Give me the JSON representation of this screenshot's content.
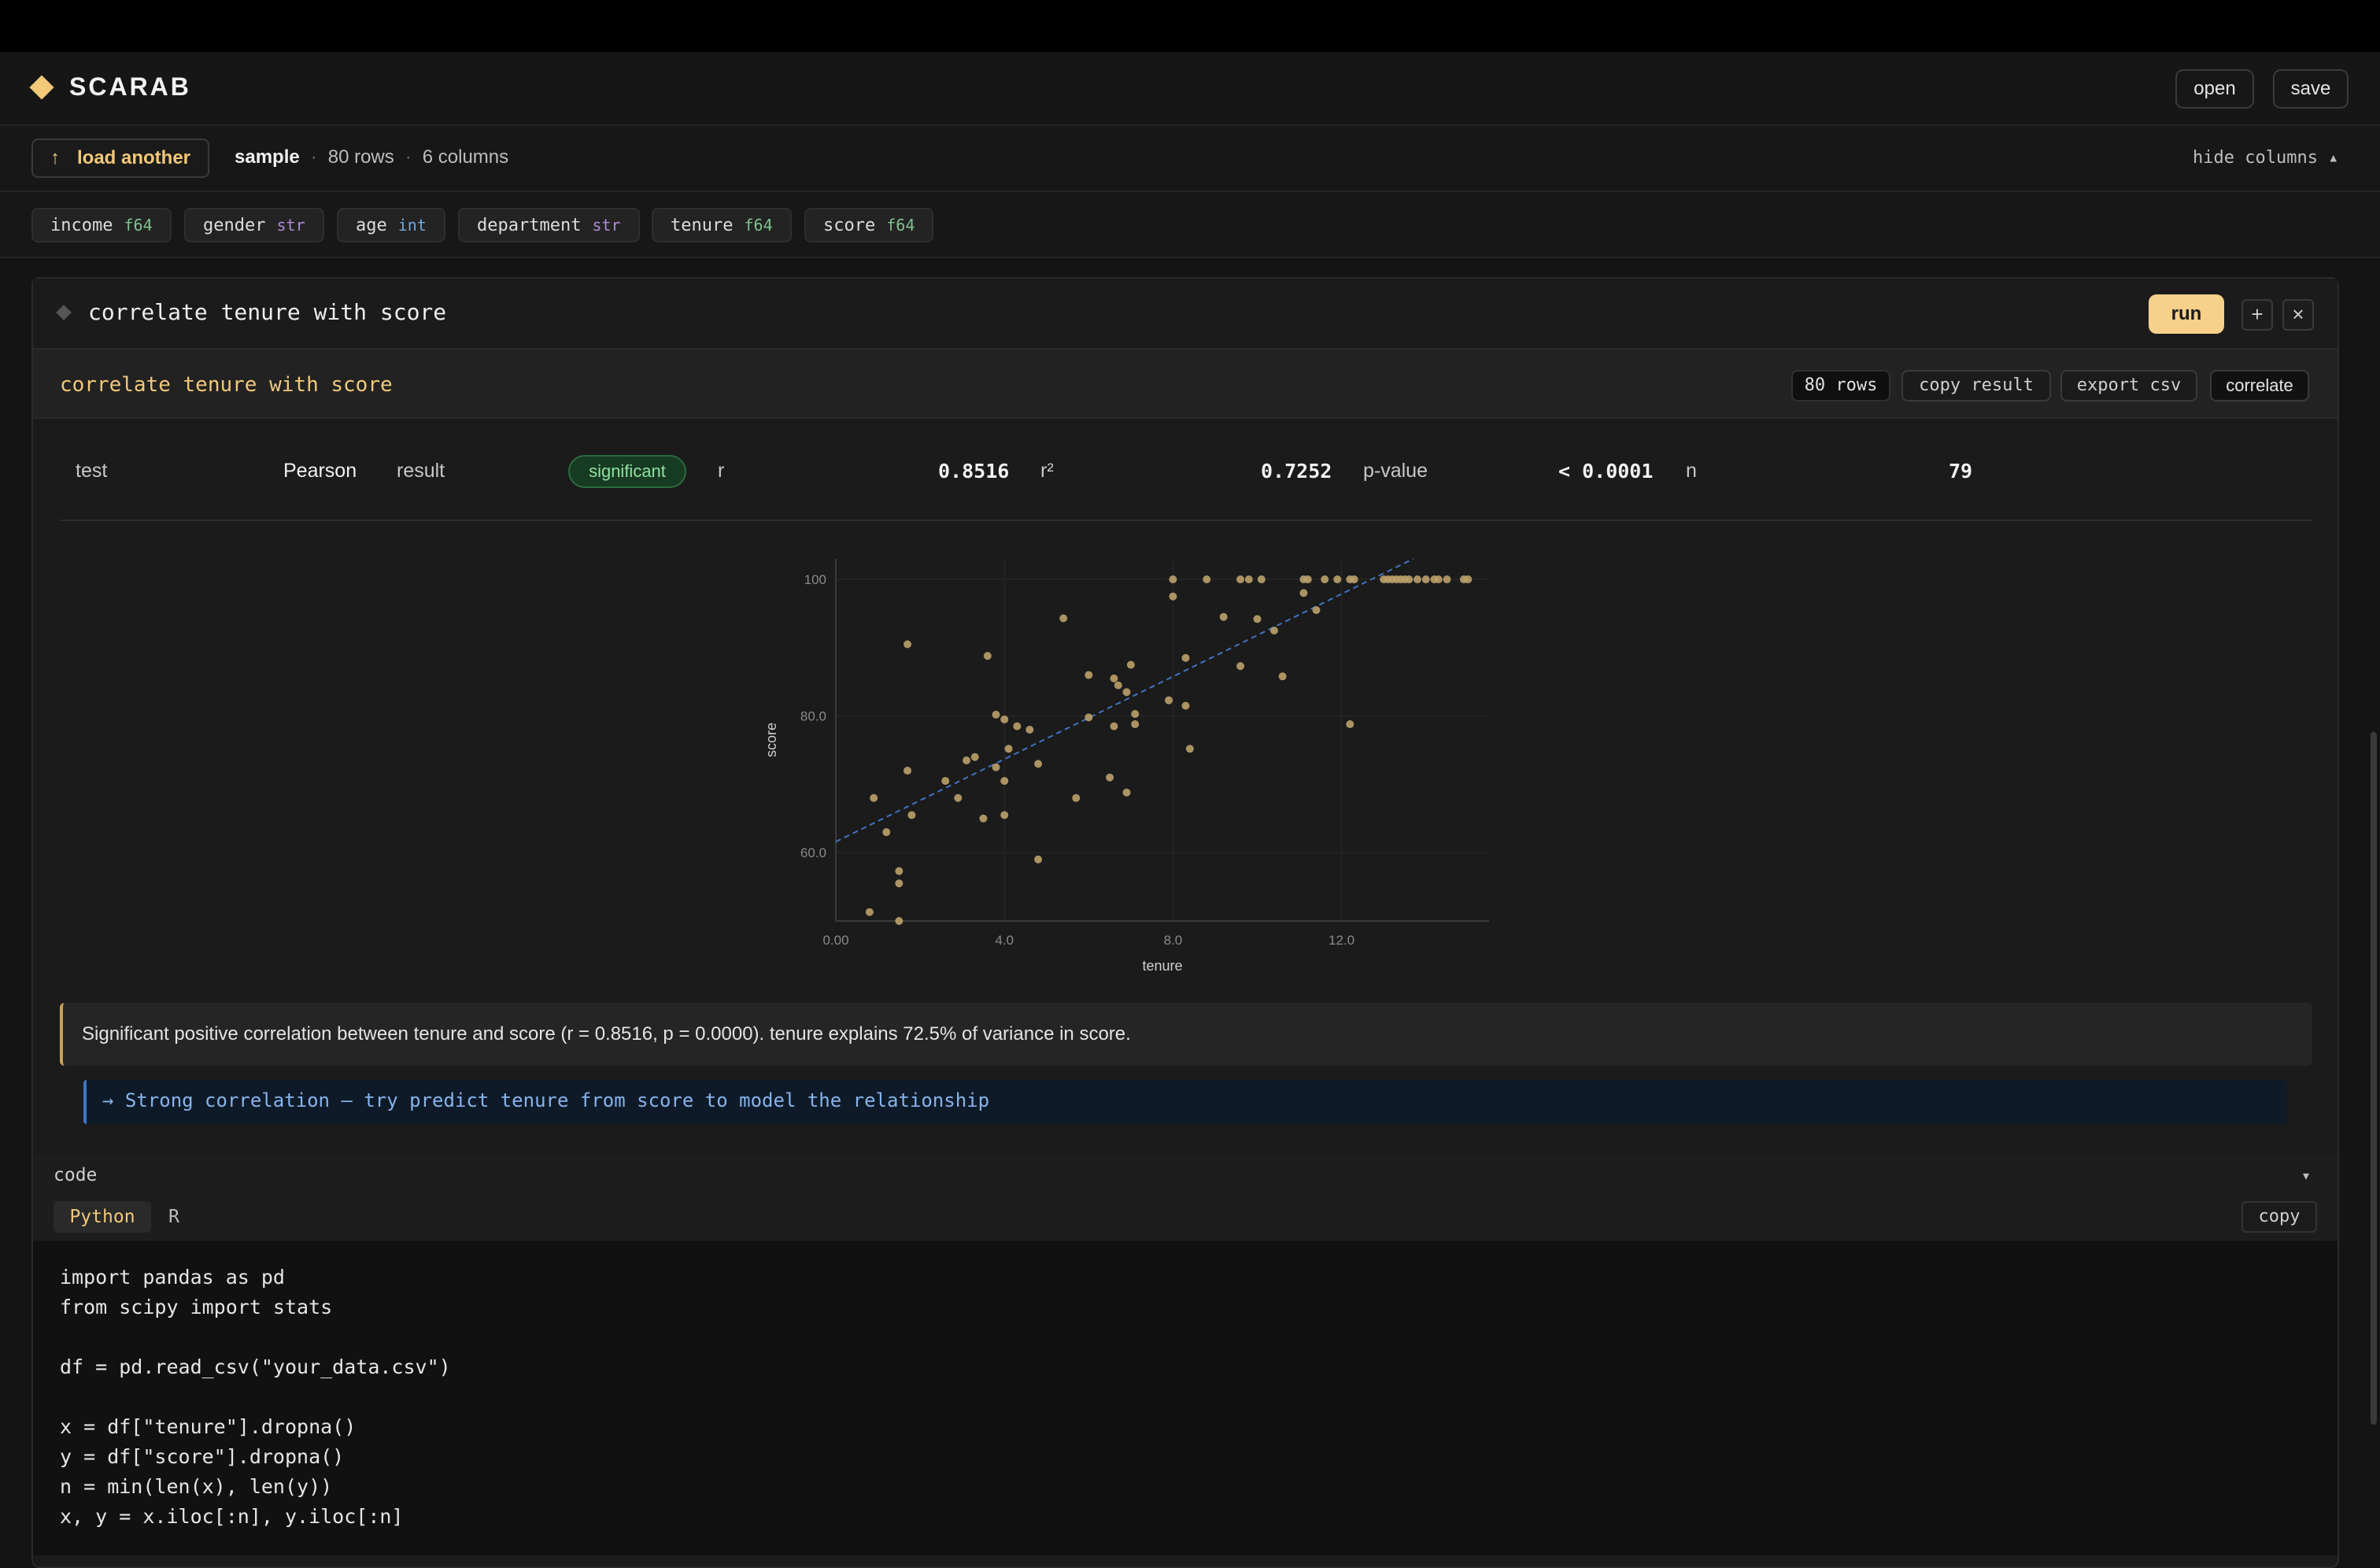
{
  "app": {
    "title": "SCARAB",
    "open_label": "open",
    "save_label": "save"
  },
  "databar": {
    "load_arrow": "↑",
    "load_label": "load another",
    "dataset_name": "sample",
    "separator": "·",
    "rows": "80 rows",
    "columns": "6 columns",
    "hide_columns": "hide columns ▴"
  },
  "columns": [
    {
      "name": "income",
      "type": "f64"
    },
    {
      "name": "gender",
      "type": "str"
    },
    {
      "name": "age",
      "type": "int"
    },
    {
      "name": "department",
      "type": "str"
    },
    {
      "name": "tenure",
      "type": "f64"
    },
    {
      "name": "score",
      "type": "f64"
    }
  ],
  "cell": {
    "query": "correlate tenure with score",
    "run_label": "run",
    "add_icon": "+",
    "close_icon": "×"
  },
  "result": {
    "title": "correlate tenure with score",
    "rows_chip": "80 rows",
    "copy_result": "copy result",
    "export_csv": "export csv",
    "method_chip": "correlate",
    "stats": {
      "test_label": "test",
      "test_value": "Pearson",
      "result_label": "result",
      "result_badge": "significant",
      "r_label": "r",
      "r_value": "0.8516",
      "r2_label": "r²",
      "r2_value": "0.7252",
      "p_label": "p-value",
      "p_value": "< 0.0001",
      "n_label": "n",
      "n_value": "79"
    },
    "summary": "Significant positive correlation between tenure and score (r = 0.8516, p = 0.0000). tenure explains 72.5% of variance in score.",
    "hint": "→ Strong correlation — try predict tenure from score to model the relationship"
  },
  "chart_data": {
    "type": "scatter",
    "title": "",
    "xlabel": "tenure",
    "ylabel": "score",
    "xlim": [
      0,
      15.5
    ],
    "ylim": [
      50,
      103
    ],
    "x_ticks": [
      0,
      4,
      8,
      12
    ],
    "x_tick_labels": [
      "0.00",
      "4.0",
      "8.0",
      "12.0"
    ],
    "y_ticks": [
      60,
      80,
      100
    ],
    "y_tick_labels": [
      "60.0",
      "80.0",
      "100"
    ],
    "grid": true,
    "point_color": "#bba16a",
    "trend_color": "#3f74c2",
    "trendline": {
      "x": [
        0,
        13.7
      ],
      "y": [
        61.6,
        103
      ]
    },
    "points": [
      {
        "x": 0.8,
        "y": 51.3
      },
      {
        "x": 1.5,
        "y": 50
      },
      {
        "x": 1.5,
        "y": 55.5
      },
      {
        "x": 1.5,
        "y": 57.3
      },
      {
        "x": 0.9,
        "y": 68
      },
      {
        "x": 1.2,
        "y": 63
      },
      {
        "x": 1.7,
        "y": 72
      },
      {
        "x": 1.8,
        "y": 65.5
      },
      {
        "x": 1.7,
        "y": 90.5
      },
      {
        "x": 2.6,
        "y": 70.5
      },
      {
        "x": 2.9,
        "y": 68
      },
      {
        "x": 3.1,
        "y": 73.5
      },
      {
        "x": 3.3,
        "y": 74
      },
      {
        "x": 3.5,
        "y": 65
      },
      {
        "x": 3.6,
        "y": 88.8
      },
      {
        "x": 3.8,
        "y": 72.5
      },
      {
        "x": 3.8,
        "y": 80.2
      },
      {
        "x": 4.0,
        "y": 79.5
      },
      {
        "x": 4.0,
        "y": 70.5
      },
      {
        "x": 4.0,
        "y": 65.5
      },
      {
        "x": 4.1,
        "y": 75.2
      },
      {
        "x": 4.3,
        "y": 78.5
      },
      {
        "x": 4.6,
        "y": 78
      },
      {
        "x": 4.8,
        "y": 73
      },
      {
        "x": 4.8,
        "y": 59
      },
      {
        "x": 5.4,
        "y": 94.3
      },
      {
        "x": 5.7,
        "y": 68
      },
      {
        "x": 6.0,
        "y": 79.8
      },
      {
        "x": 6.0,
        "y": 86
      },
      {
        "x": 6.5,
        "y": 71
      },
      {
        "x": 6.6,
        "y": 85.5
      },
      {
        "x": 6.6,
        "y": 78.5
      },
      {
        "x": 6.7,
        "y": 84.5
      },
      {
        "x": 6.9,
        "y": 83.5
      },
      {
        "x": 6.9,
        "y": 68.8
      },
      {
        "x": 7.0,
        "y": 87.5
      },
      {
        "x": 7.1,
        "y": 80.3
      },
      {
        "x": 7.1,
        "y": 78.8
      },
      {
        "x": 7.9,
        "y": 82.3
      },
      {
        "x": 8.0,
        "y": 100
      },
      {
        "x": 8.0,
        "y": 97.5
      },
      {
        "x": 8.3,
        "y": 81.5
      },
      {
        "x": 8.3,
        "y": 88.5
      },
      {
        "x": 8.4,
        "y": 75.2
      },
      {
        "x": 8.8,
        "y": 100
      },
      {
        "x": 9.2,
        "y": 94.5
      },
      {
        "x": 9.6,
        "y": 87.3
      },
      {
        "x": 9.6,
        "y": 100
      },
      {
        "x": 9.8,
        "y": 100
      },
      {
        "x": 10.0,
        "y": 94.2
      },
      {
        "x": 10.1,
        "y": 100
      },
      {
        "x": 10.4,
        "y": 92.5
      },
      {
        "x": 10.6,
        "y": 85.8
      },
      {
        "x": 11.1,
        "y": 100
      },
      {
        "x": 11.1,
        "y": 98
      },
      {
        "x": 11.2,
        "y": 100
      },
      {
        "x": 11.4,
        "y": 95.5
      },
      {
        "x": 11.6,
        "y": 100
      },
      {
        "x": 11.9,
        "y": 100
      },
      {
        "x": 12.2,
        "y": 100
      },
      {
        "x": 12.2,
        "y": 78.8
      },
      {
        "x": 12.3,
        "y": 100
      },
      {
        "x": 13.0,
        "y": 100
      },
      {
        "x": 13.1,
        "y": 100
      },
      {
        "x": 13.2,
        "y": 100
      },
      {
        "x": 13.3,
        "y": 100
      },
      {
        "x": 13.4,
        "y": 100
      },
      {
        "x": 13.5,
        "y": 100
      },
      {
        "x": 13.6,
        "y": 100
      },
      {
        "x": 13.8,
        "y": 100
      },
      {
        "x": 14.0,
        "y": 100
      },
      {
        "x": 14.2,
        "y": 100
      },
      {
        "x": 14.3,
        "y": 100
      },
      {
        "x": 14.5,
        "y": 100
      },
      {
        "x": 14.9,
        "y": 100
      },
      {
        "x": 15.0,
        "y": 100
      }
    ]
  },
  "code": {
    "section_label": "code",
    "caret": "▾",
    "tabs": [
      "Python",
      "R"
    ],
    "copy_label": "copy",
    "lines": "import pandas as pd\nfrom scipy import stats\n\ndf = pd.read_csv(\"your_data.csv\")\n\nx = df[\"tenure\"].dropna()\ny = df[\"score\"].dropna()\nn = min(len(x), len(y))\nx, y = x.iloc[:n], y.iloc[:n]"
  }
}
